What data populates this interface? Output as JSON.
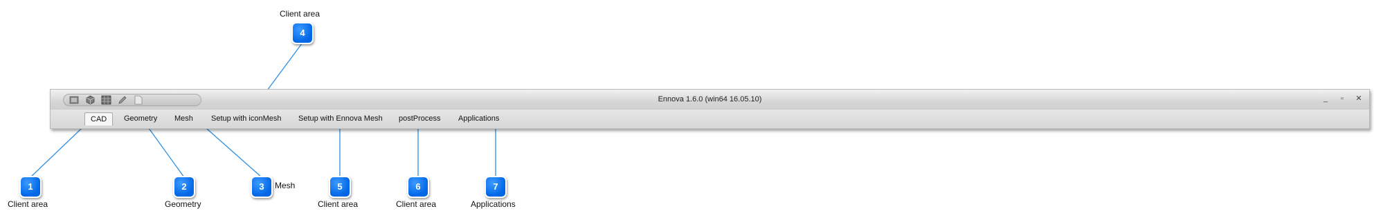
{
  "window": {
    "title": "Ennova 1.6.0 (win64 16.05.10)",
    "quick_access_icons": [
      "open-icon",
      "cube-icon",
      "mesh-icon",
      "edit-icon",
      "document-icon"
    ],
    "controls": {
      "minimize": "_",
      "maximize": "▫",
      "close": "✕"
    }
  },
  "ribbon": {
    "tabs": [
      {
        "label": "CAD",
        "active": true
      },
      {
        "label": "Geometry"
      },
      {
        "label": "Mesh"
      },
      {
        "label": "Setup with iconMesh"
      },
      {
        "label": "Setup with Ennova Mesh"
      },
      {
        "label": "postProcess"
      },
      {
        "label": "Applications"
      }
    ]
  },
  "callouts": [
    {
      "number": "1",
      "caption": "Client area"
    },
    {
      "number": "2",
      "caption": "Geometry"
    },
    {
      "number": "3",
      "caption": "Mesh"
    },
    {
      "number": "4",
      "caption": "Client area"
    },
    {
      "number": "5",
      "caption": "Client area"
    },
    {
      "number": "6",
      "caption": "Client area"
    },
    {
      "number": "7",
      "caption": "Applications"
    }
  ],
  "colors": {
    "badge": "#0a6fe8",
    "leader_line": "#2e8fe0",
    "ribbon": "#d7d7d7"
  }
}
